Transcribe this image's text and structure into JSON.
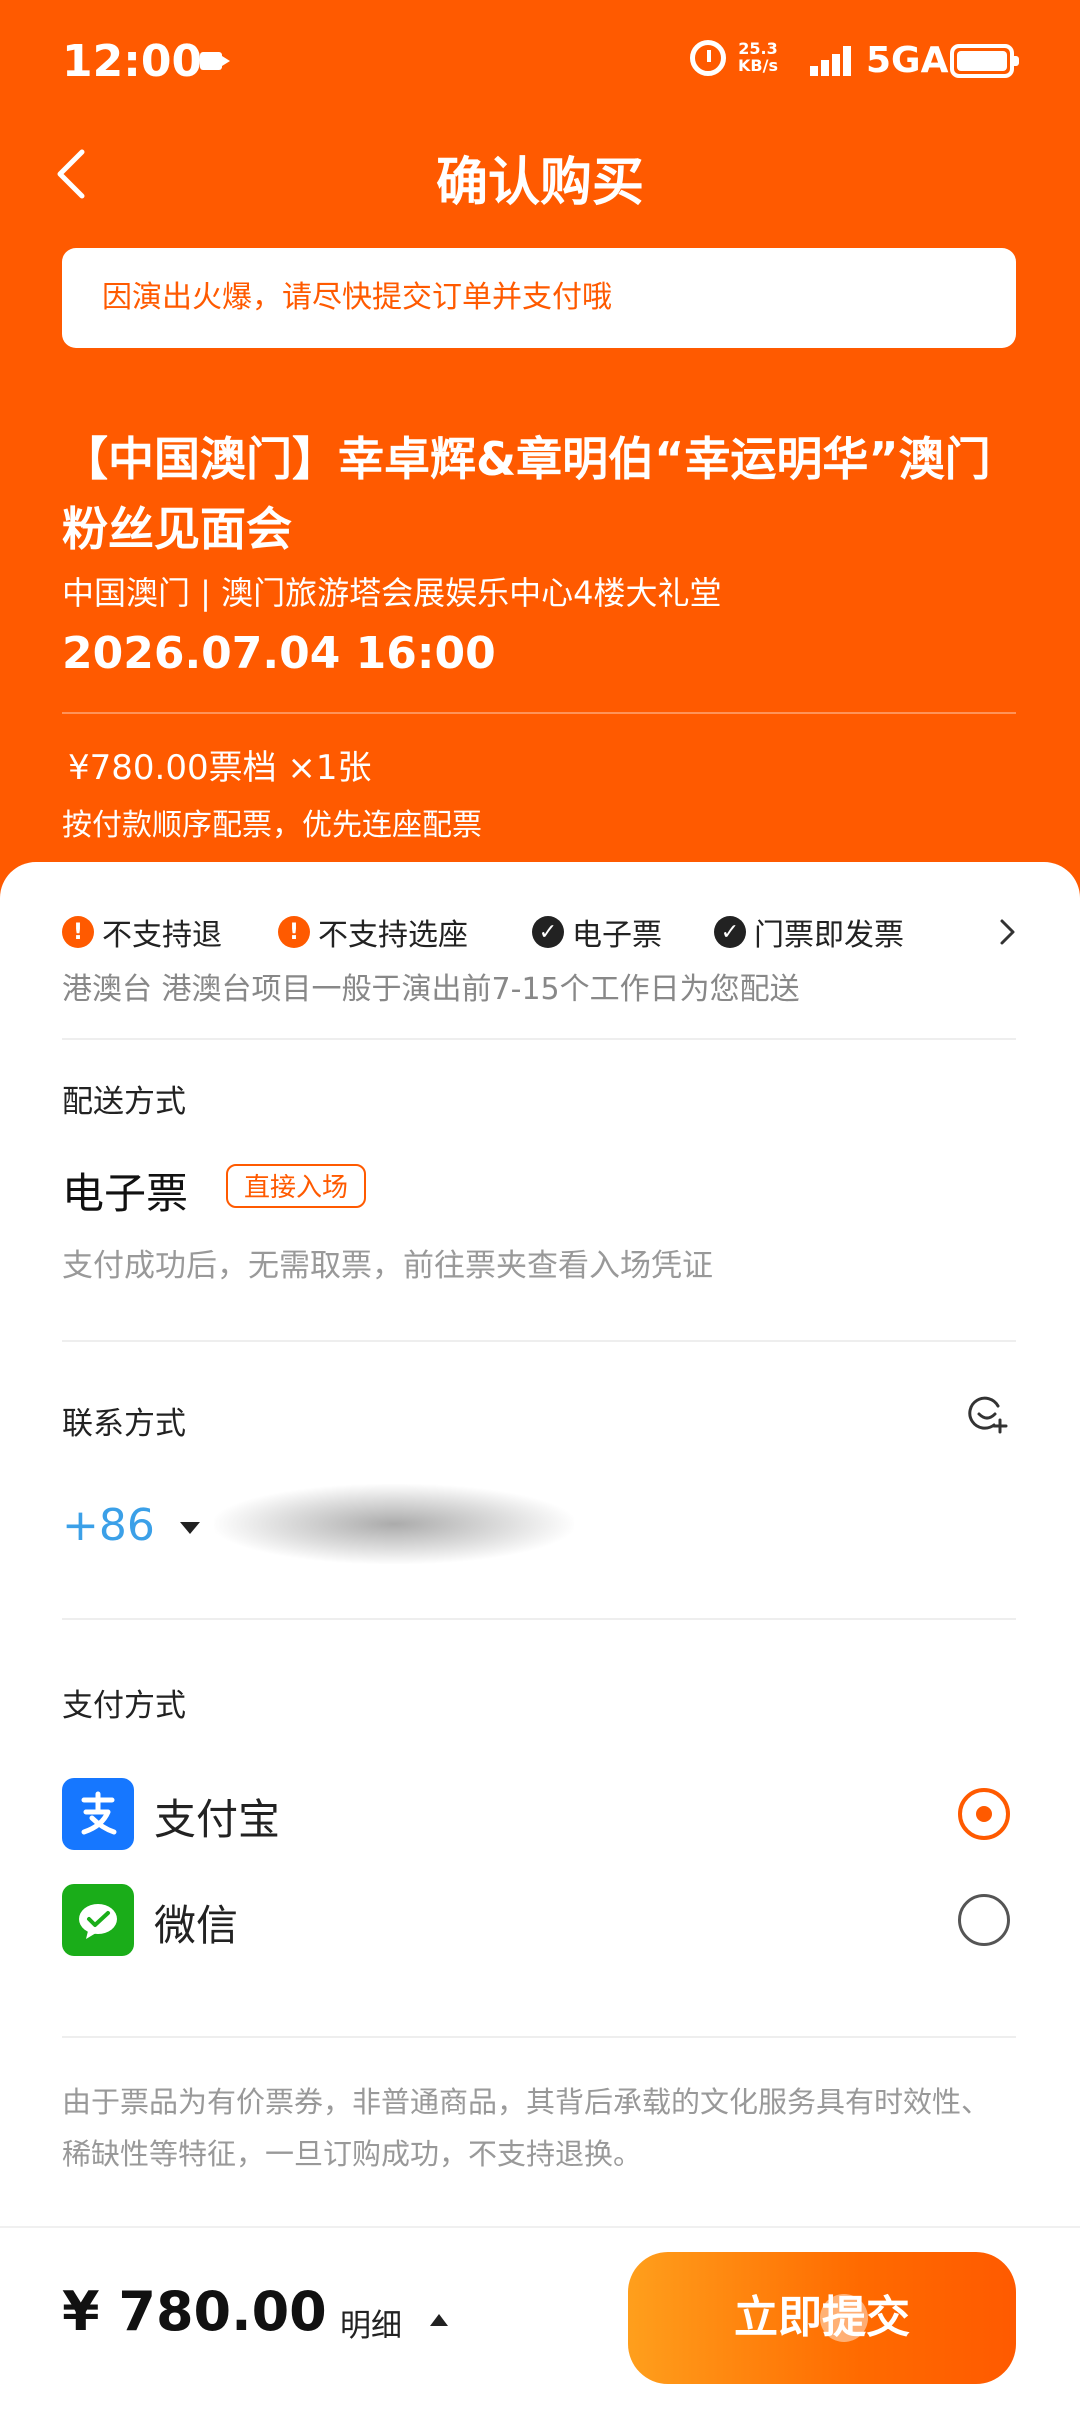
{
  "status_bar": {
    "time": "12:00",
    "net_speed_value": "25.3",
    "net_speed_unit": "KB/s",
    "network": "5GA"
  },
  "header": {
    "title": "确认购买",
    "notice": "因演出火爆，请尽快提交订单并支付哦"
  },
  "event": {
    "title": "【中国澳门】幸卓辉&章明伯“幸运明华”澳门粉丝见面会",
    "venue": "中国澳门 | 澳门旅游塔会展娱乐中心4楼大礼堂",
    "datetime": "2026.07.04 16:00",
    "ticket_price": "¥780.00票档  ×1张",
    "ticket_rule": "按付款顺序配票，优先连座配票"
  },
  "tags": [
    {
      "label": "不支持退",
      "type": "warning",
      "icon": "warning-icon"
    },
    {
      "label": "不支持选座",
      "type": "warning",
      "icon": "warning-icon"
    },
    {
      "label": "电子票",
      "type": "ok",
      "icon": "check-icon"
    },
    {
      "label": "门票即发票",
      "type": "ok",
      "icon": "check-icon"
    }
  ],
  "delivery_note": "港澳台  港澳台项目一般于演出前7-15个工作日为您配送",
  "delivery": {
    "label": "配送方式",
    "method": "电子票",
    "badge": "直接入场",
    "desc": "支付成功后，无需取票，前往票夹查看入场凭证"
  },
  "contact": {
    "label": "联系方式",
    "country_code": "+86"
  },
  "payment": {
    "label": "支付方式",
    "options": [
      {
        "name": "支付宝",
        "logo": "alipay-logo",
        "color": "#1677ff",
        "selected": true
      },
      {
        "name": "微信",
        "logo": "wechat-logo",
        "color": "#1aad19",
        "selected": false
      }
    ]
  },
  "disclaimer": "由于票品为有价票券，非普通商品，其背后承载的文化服务具有时效性、稀缺性等特征，一旦订购成功，不支持退换。",
  "footer": {
    "total": "¥ 780.00",
    "detail_label": "明细",
    "submit_label": "立即提交"
  },
  "colors": {
    "accent": "#ff5a00",
    "phone_code": "#3ba0e8"
  }
}
